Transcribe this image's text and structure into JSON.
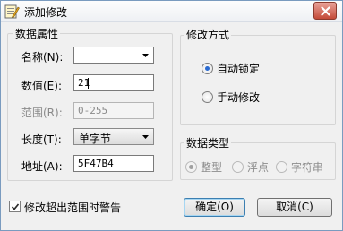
{
  "window": {
    "title": "添加修改",
    "icon": "edit-document-icon",
    "close_icon": "close-icon"
  },
  "data_attributes": {
    "group_title": "数据属性",
    "name": {
      "label": "名称(N):",
      "value": ""
    },
    "value": {
      "label": "数值(E):",
      "value": "21"
    },
    "range": {
      "label": "范围(R):",
      "value": "0-255"
    },
    "length": {
      "label": "长度(T):",
      "selected": "单字节"
    },
    "address": {
      "label": "地址(A):",
      "value": "5F47B4"
    }
  },
  "modify_mode": {
    "group_title": "修改方式",
    "options": [
      {
        "label": "自动锁定",
        "checked": true
      },
      {
        "label": "手动修改",
        "checked": false
      }
    ]
  },
  "data_type": {
    "group_title": "数据类型",
    "options": [
      {
        "label": "整型",
        "checked": true,
        "disabled": true
      },
      {
        "label": "浮点",
        "checked": false,
        "disabled": true
      },
      {
        "label": "字符串",
        "checked": false,
        "disabled": true
      }
    ]
  },
  "warning_checkbox": {
    "label": "修改超出范围时警告",
    "checked": true
  },
  "buttons": {
    "ok": "确定(O)",
    "cancel": "取消(C)"
  },
  "colors": {
    "radio_accent": "#2a6ad0",
    "close_button": "#c44a38",
    "title_bar": "#eef0f4"
  }
}
